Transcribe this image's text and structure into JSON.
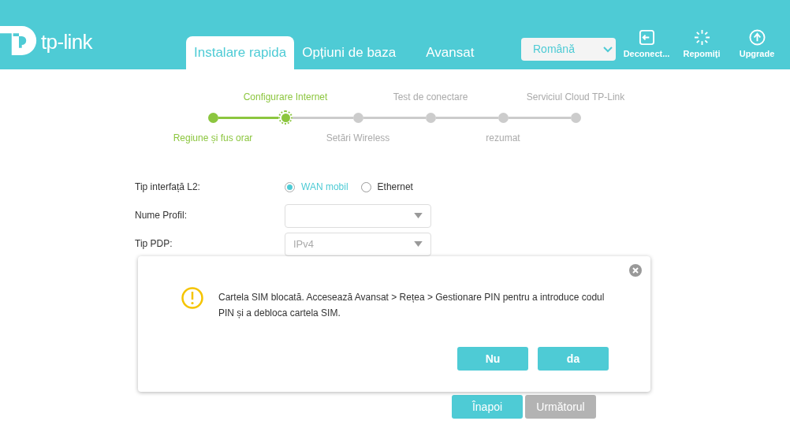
{
  "logo": {
    "text": "tp-link"
  },
  "tabs": [
    {
      "label": "Instalare rapida",
      "selected": true
    },
    {
      "label": "Opțiuni de baza",
      "selected": false
    },
    {
      "label": "Avansat",
      "selected": false
    }
  ],
  "language": {
    "value": "Română"
  },
  "header_actions": [
    {
      "kind": "logout",
      "label": "Deconect..."
    },
    {
      "kind": "reboot",
      "label": "Repomiți"
    },
    {
      "kind": "upgrade",
      "label": "Upgrade"
    }
  ],
  "steps": [
    {
      "label": "Regiune și fus orar",
      "completed": true,
      "selected": false
    },
    {
      "label": "Configurare Internet",
      "completed": true,
      "selected": true
    },
    {
      "label": "Setări Wireless",
      "completed": false,
      "selected": false
    },
    {
      "label": "Test de conectare",
      "completed": false,
      "selected": false
    },
    {
      "label": "rezumat",
      "completed": false,
      "selected": false
    },
    {
      "label": "Serviciul Cloud TP-Link",
      "completed": false,
      "selected": false
    }
  ],
  "form": [
    {
      "kind": "radio",
      "label": "Tip interfață L2:",
      "options": [
        {
          "label": "WAN mobil",
          "selected": true
        },
        {
          "label": "Ethernet",
          "selected": false
        }
      ]
    },
    {
      "kind": "select",
      "label": "Nume Profil:"
    },
    {
      "kind": "select",
      "label": "Tip PDP:",
      "value": "IPv4"
    }
  ],
  "dialog": {
    "message": "Cartela SIM blocată. Accesează Avansat > Rețea > Gestionare PIN pentru a introduce codul PIN și a debloca cartela SIM.",
    "buttons": [
      "Nu",
      "da"
    ]
  },
  "buttons": [
    {
      "label": "Înapoi",
      "kind": "primary"
    },
    {
      "label": "Următorul",
      "kind": "disabled"
    }
  ]
}
